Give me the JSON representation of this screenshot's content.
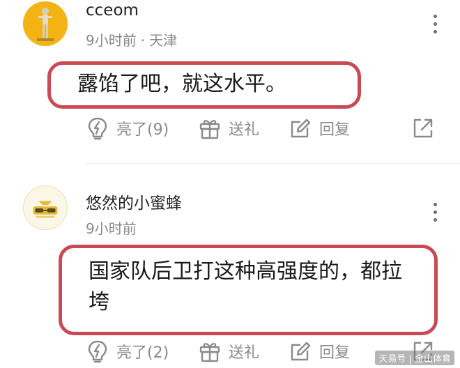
{
  "comments": [
    {
      "username": "cceom",
      "time": "9小时前",
      "separator": "·",
      "location": "天津",
      "text": "露馅了吧，就这水平。",
      "actions": {
        "like": "亮了(9)",
        "gift": "送礼",
        "reply": "回复"
      },
      "icons": {
        "avatar": "golden-figure-avatar",
        "more": "more-vertical-icon",
        "like": "lightbulb-icon",
        "gift": "gift-icon",
        "reply": "edit-reply-icon",
        "share": "share-external-icon"
      }
    },
    {
      "username": "悠然的小蜜蜂",
      "time": "9小时前",
      "text": "国家队后卫打这种高强度的，都拉垮",
      "actions": {
        "like": "亮了(2)",
        "gift": "送礼",
        "reply": "回复"
      },
      "icons": {
        "avatar": "sunglasses-avatar",
        "more": "more-vertical-icon",
        "like": "lightbulb-icon",
        "gift": "gift-icon",
        "reply": "edit-reply-icon",
        "share": "share-external-icon"
      }
    }
  ],
  "watermark": "天易号 | 金山体育",
  "colors": {
    "highlight_border": "#c94a55",
    "meta_text": "#8a8a8a",
    "avatar_gold": "#f3b315"
  }
}
